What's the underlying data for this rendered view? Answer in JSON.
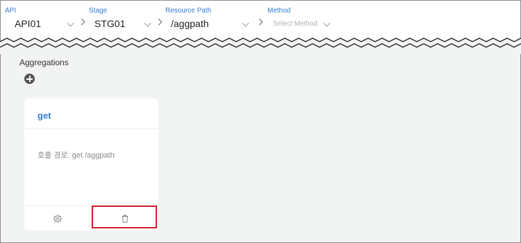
{
  "breadcrumb": {
    "api": {
      "label": "API",
      "value": "API01"
    },
    "stage": {
      "label": "Stage",
      "value": "STG01"
    },
    "resource_path": {
      "label": "Resource Path",
      "value": "/aggpath"
    },
    "method": {
      "label": "Method",
      "placeholder": "Select Method"
    }
  },
  "section": {
    "title": "Aggregations"
  },
  "cards": [
    {
      "title": "get",
      "path_text": "호출 경로: get /aggpath"
    }
  ],
  "icons": {
    "add": "plus-circle-icon",
    "settings": "gear-icon",
    "delete": "trash-icon",
    "dropdown": "chevron-down-icon",
    "separator": "chevron-right-icon"
  },
  "colors": {
    "accent": "#2f7dd8",
    "highlight": "#d31f26",
    "background": "#f2f3f3"
  }
}
